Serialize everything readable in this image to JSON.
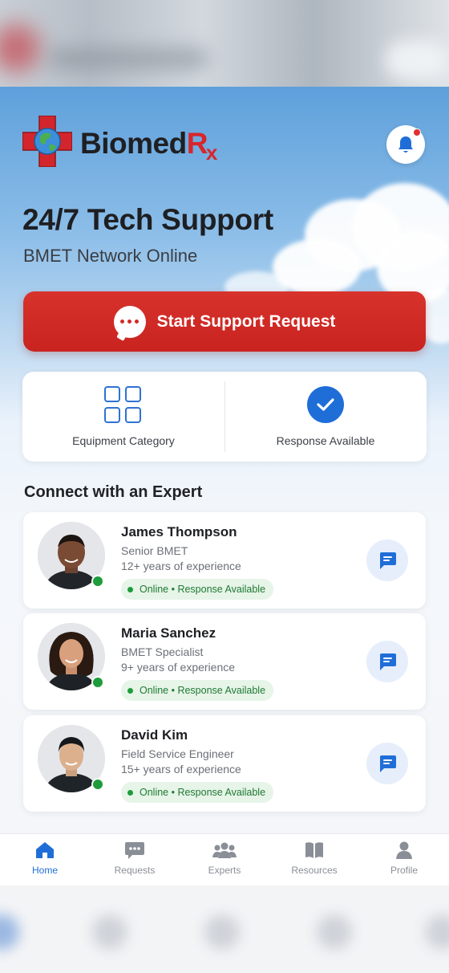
{
  "brand": {
    "name_main": "Biomed",
    "name_r": "R",
    "name_x": "x"
  },
  "hero": {
    "title": "24/7 Tech Support",
    "subtitle": "BMET Network Online"
  },
  "cta": {
    "label": "Start Support Request"
  },
  "quick_actions": [
    {
      "label": "Equipment Category",
      "icon": "grid-icon"
    },
    {
      "label": "Response Available",
      "icon": "check-circle-icon"
    }
  ],
  "experts_section": {
    "title": "Connect with an Expert"
  },
  "experts": [
    {
      "name": "James Thompson",
      "role": "Senior BMET",
      "experience": "12+ years of experience",
      "status": "Online • Response Available"
    },
    {
      "name": "Maria Sanchez",
      "role": "BMET Specialist",
      "experience": "9+ years of experience",
      "status": "Online • Response Available"
    },
    {
      "name": "David Kim",
      "role": "Field Service Engineer",
      "experience": "15+ years of experience",
      "status": "Online • Response Available"
    }
  ],
  "tabs": [
    {
      "label": "Home",
      "icon": "home-icon",
      "active": true
    },
    {
      "label": "Requests",
      "icon": "chat-icon"
    },
    {
      "label": "Experts",
      "icon": "people-icon"
    },
    {
      "label": "Resources",
      "icon": "book-icon"
    },
    {
      "label": "Profile",
      "icon": "person-icon"
    }
  ],
  "colors": {
    "brand_red": "#d7262c",
    "accent_blue": "#1f6ed8",
    "online_green": "#1e9c3b"
  }
}
